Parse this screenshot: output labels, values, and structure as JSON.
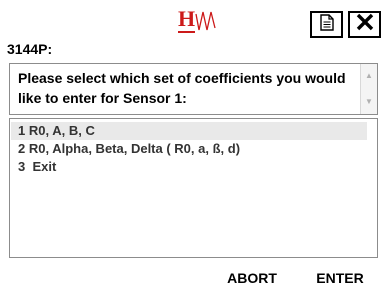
{
  "header": {
    "logo_text": "HW",
    "doc_icon": "document-icon",
    "close_icon": "close-icon"
  },
  "device_label": "3144P:",
  "prompt": {
    "text": "Please select which set of coefficients you would like to enter for Sensor 1:"
  },
  "options": [
    {
      "number": "1",
      "label": "R0, A, B, C"
    },
    {
      "number": "2",
      "label": "R0, Alpha, Beta, Delta ( R0, a, ß, d)"
    },
    {
      "number": "3",
      "label": " Exit"
    }
  ],
  "buttons": {
    "abort": "ABORT",
    "enter": "ENTER"
  },
  "colors": {
    "logo_red": "#cc1a1a",
    "selected_row": "#e9e9e9",
    "border": "#8c8c8c"
  }
}
